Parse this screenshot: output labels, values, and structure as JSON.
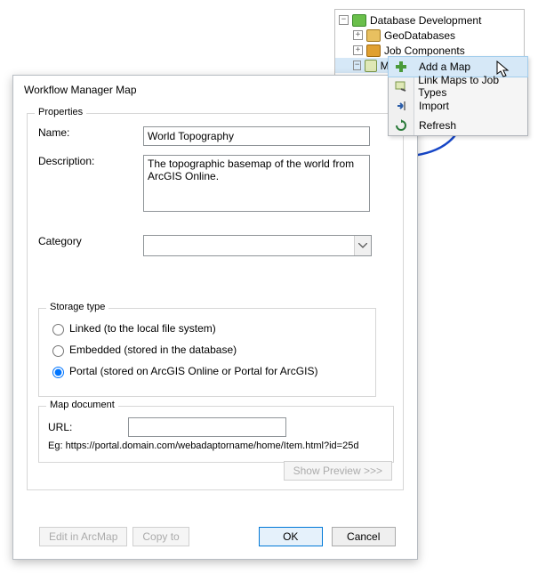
{
  "tree": {
    "root": "Database Development",
    "children": [
      "GeoDatabases",
      "Job Components",
      "Maps"
    ]
  },
  "context_menu": {
    "items": [
      "Add a Map",
      "Link Maps to Job Types",
      "Import",
      "Refresh"
    ],
    "highlighted_index": 0
  },
  "dialog": {
    "title": "Workflow Manager Map",
    "groupbox_props": "Properties",
    "name_label": "Name:",
    "name_value": "World Topography",
    "description_label": "Description:",
    "description_value": "The topographic basemap of the world from ArcGIS Online.",
    "category_label": "Category",
    "category_value": "",
    "groupbox_storage": "Storage type",
    "storage_options": [
      "Linked (to the local file system)",
      "Embedded (stored in the database)",
      "Portal (stored on ArcGIS Online or Portal for ArcGIS)"
    ],
    "storage_selected_index": 2,
    "groupbox_mapdoc": "Map document",
    "url_label": "URL:",
    "url_value": "",
    "url_example": "Eg:  https://portal.domain.com/webadaptorname/home/Item.html?id=25d",
    "buttons": {
      "show_preview": "Show Preview >>>",
      "edit_in_arcmap": "Edit in ArcMap",
      "copy_to": "Copy to",
      "ok": "OK",
      "cancel": "Cancel"
    }
  }
}
